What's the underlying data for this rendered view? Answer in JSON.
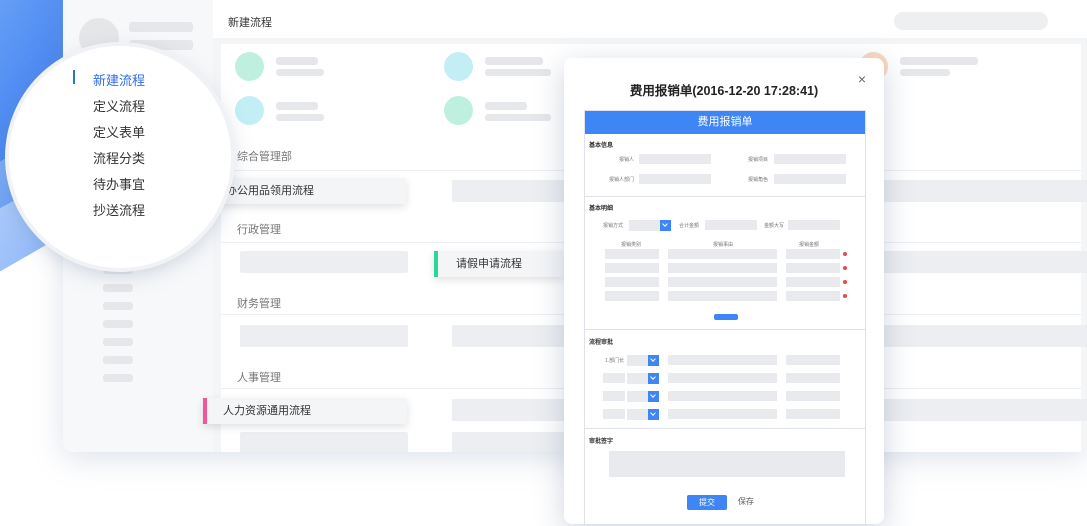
{
  "app": {
    "page_title": "新建流程",
    "sidebar_menu": [
      {
        "label": "新建流程",
        "active": true
      },
      {
        "label": "定义流程",
        "active": false
      },
      {
        "label": "定义表单",
        "active": false
      },
      {
        "label": "流程分类",
        "active": false
      },
      {
        "label": "待办事宜",
        "active": false
      },
      {
        "label": "抄送流程",
        "active": false
      }
    ],
    "sections": [
      "综合管理部",
      "行政管理",
      "财务管理",
      "人事管理"
    ],
    "workflow_cards": [
      {
        "label": "办公用品领用流程",
        "color": "#e9e9ec"
      },
      {
        "label": "请假申请流程",
        "color": "#2fd49a"
      },
      {
        "label": "人力资源通用流程",
        "color": "#f2559a"
      }
    ]
  },
  "dialog": {
    "title": "费用报销单(2016-12-20 17:28:41)",
    "close_icon": "×",
    "form_header": "费用报销单",
    "basic_info": {
      "title": "基本信息",
      "fields": [
        "报销人",
        "报销项目",
        "报销人部门",
        "报销角色"
      ]
    },
    "detail": {
      "title": "基本明细",
      "fields": [
        "报销方式",
        "合计金额",
        "金额大写"
      ],
      "columns": [
        "报销类别",
        "报销事由",
        "报销金额"
      ]
    },
    "approval": {
      "title": "流程审批",
      "first_label": "1.部门长"
    },
    "signature": {
      "title": "审批签字"
    },
    "submit_label": "提交",
    "save_label": "保存"
  },
  "colors": {
    "accent": "#3e86f5",
    "green": "#2fd49a",
    "pink": "#f2559a"
  }
}
